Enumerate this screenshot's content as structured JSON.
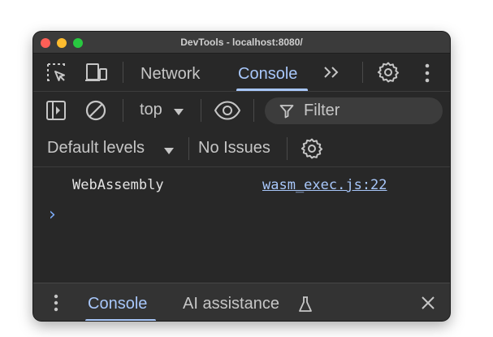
{
  "window": {
    "title": "DevTools - localhost:8080/"
  },
  "toolbar": {
    "tabs": [
      {
        "label": "Network",
        "active": false
      },
      {
        "label": "Console",
        "active": true
      }
    ],
    "icons": [
      "inspect-element-icon",
      "device-toolbar-icon",
      "more-tabs-icon",
      "settings-gear-icon",
      "kebab-menu-icon"
    ]
  },
  "console_toolbar": {
    "context": "top",
    "filter_placeholder": "Filter",
    "levels": "Default levels",
    "issues": "No Issues"
  },
  "console": {
    "messages": [
      {
        "text": "WebAssembly",
        "source": "wasm_exec.js:22"
      }
    ],
    "prompt": "›"
  },
  "drawer": {
    "tabs": [
      {
        "label": "Console",
        "active": true
      },
      {
        "label": "AI assistance",
        "active": false
      }
    ]
  },
  "colors": {
    "accent": "#a8c7fa",
    "background": "#282828",
    "text": "#c6c6c6"
  }
}
